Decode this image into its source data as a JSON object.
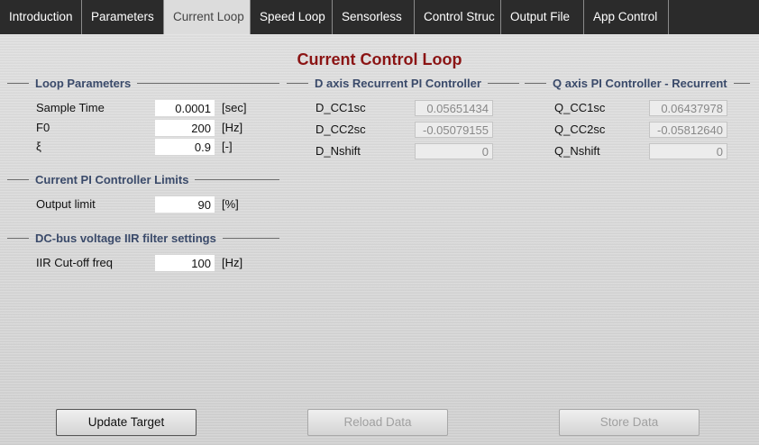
{
  "tabs": [
    {
      "label": "Introduction"
    },
    {
      "label": "Parameters"
    },
    {
      "label": "Current Loop"
    },
    {
      "label": "Speed Loop"
    },
    {
      "label": "Sensorless"
    },
    {
      "label": "Control Struc"
    },
    {
      "label": "Output File"
    },
    {
      "label": "App Control"
    }
  ],
  "active_tab": "Current Loop",
  "page_title": "Current Control Loop",
  "loop_parameters": {
    "title": "Loop Parameters",
    "sample_time": {
      "label": "Sample Time",
      "value": "0.0001",
      "unit": "[sec]"
    },
    "f0": {
      "label": "F0",
      "value": "200",
      "unit": "[Hz]"
    },
    "xi": {
      "label": "ξ",
      "value": "0.9",
      "unit": "[-]"
    }
  },
  "pi_limits": {
    "title": "Current PI Controller Limits",
    "output_limit": {
      "label": "Output limit",
      "value": "90",
      "unit": "[%]"
    }
  },
  "dcbus_filter": {
    "title": "DC-bus voltage IIR filter settings",
    "cutoff": {
      "label": "IIR Cut-off freq",
      "value": "100",
      "unit": "[Hz]"
    }
  },
  "d_axis": {
    "title": "D axis Recurrent PI Controller",
    "cc1sc": {
      "label": "D_CC1sc",
      "value": "0.05651434"
    },
    "cc2sc": {
      "label": "D_CC2sc",
      "value": "-0.05079155"
    },
    "nshift": {
      "label": "D_Nshift",
      "value": "0"
    }
  },
  "q_axis": {
    "title": "Q axis PI Controller - Recurrent",
    "cc1sc": {
      "label": "Q_CC1sc",
      "value": "0.06437978"
    },
    "cc2sc": {
      "label": "Q_CC2sc",
      "value": "-0.05812640"
    },
    "nshift": {
      "label": "Q_Nshift",
      "value": "0"
    }
  },
  "buttons": {
    "update": "Update Target",
    "reload": "Reload Data",
    "store": "Store Data"
  },
  "colors": {
    "tabbar": "#2b2b2b",
    "title": "#8b1414",
    "group_title": "#3a4a6a"
  }
}
